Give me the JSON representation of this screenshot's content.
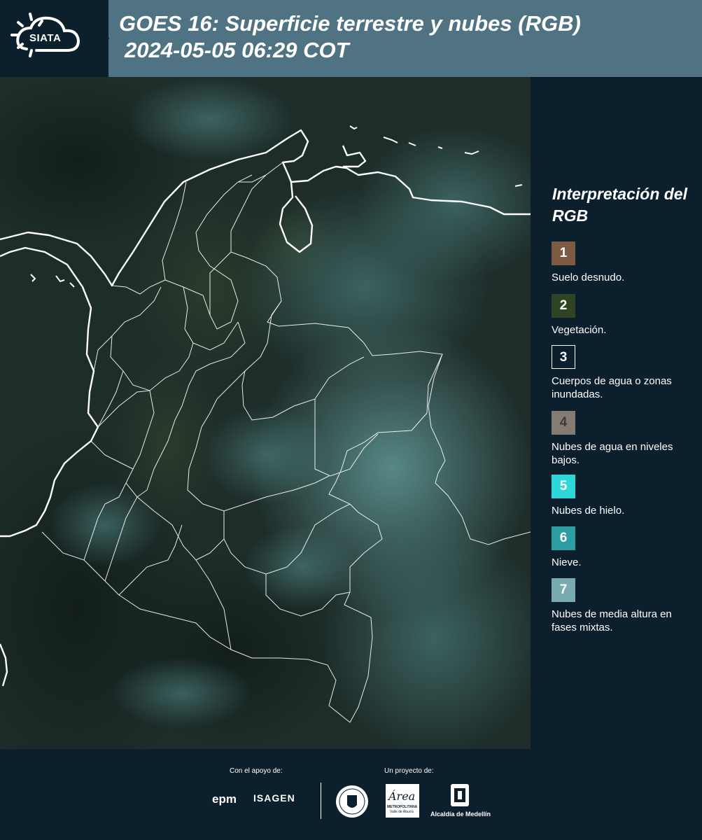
{
  "header": {
    "logo_text": "SIATA",
    "title_line1": "GOES 16: Superficie terrestre y nubes (RGB)",
    "title_line2": "2024-05-05 06:29 COT"
  },
  "legend": {
    "title": "Interpretación del RGB",
    "items": [
      {
        "num": "1",
        "label": "Suelo desnudo.",
        "color": "#7d5a43"
      },
      {
        "num": "2",
        "label": "Vegetación.",
        "color": "#2e4423"
      },
      {
        "num": "3",
        "label": "Cuerpos de agua o zonas inundadas.",
        "color": "#0c1f2c"
      },
      {
        "num": "4",
        "label": "Nubes de agua en niveles bajos.",
        "color": "#847b72"
      },
      {
        "num": "5",
        "label": "Nubes de hielo.",
        "color": "#2ed8d8"
      },
      {
        "num": "6",
        "label": "Nieve.",
        "color": "#2b9da3"
      },
      {
        "num": "7",
        "label": "Nubes de media altura en fases mixtas.",
        "color": "#79aab0"
      }
    ]
  },
  "footer": {
    "support_label": "Con el apoyo de:",
    "project_label": "Un proyecto de:",
    "epm": "epm",
    "isagen": "ISAGEN",
    "area_logo": "Área",
    "area_sub1": "METROPOLITANA",
    "area_sub2": "Valle de Aburrá",
    "medellin": "Alcaldía de Medellín"
  },
  "map": {
    "background_color": "#1b2b28",
    "cloud_color": "#5f9a98",
    "border_color": "#ffffff"
  }
}
